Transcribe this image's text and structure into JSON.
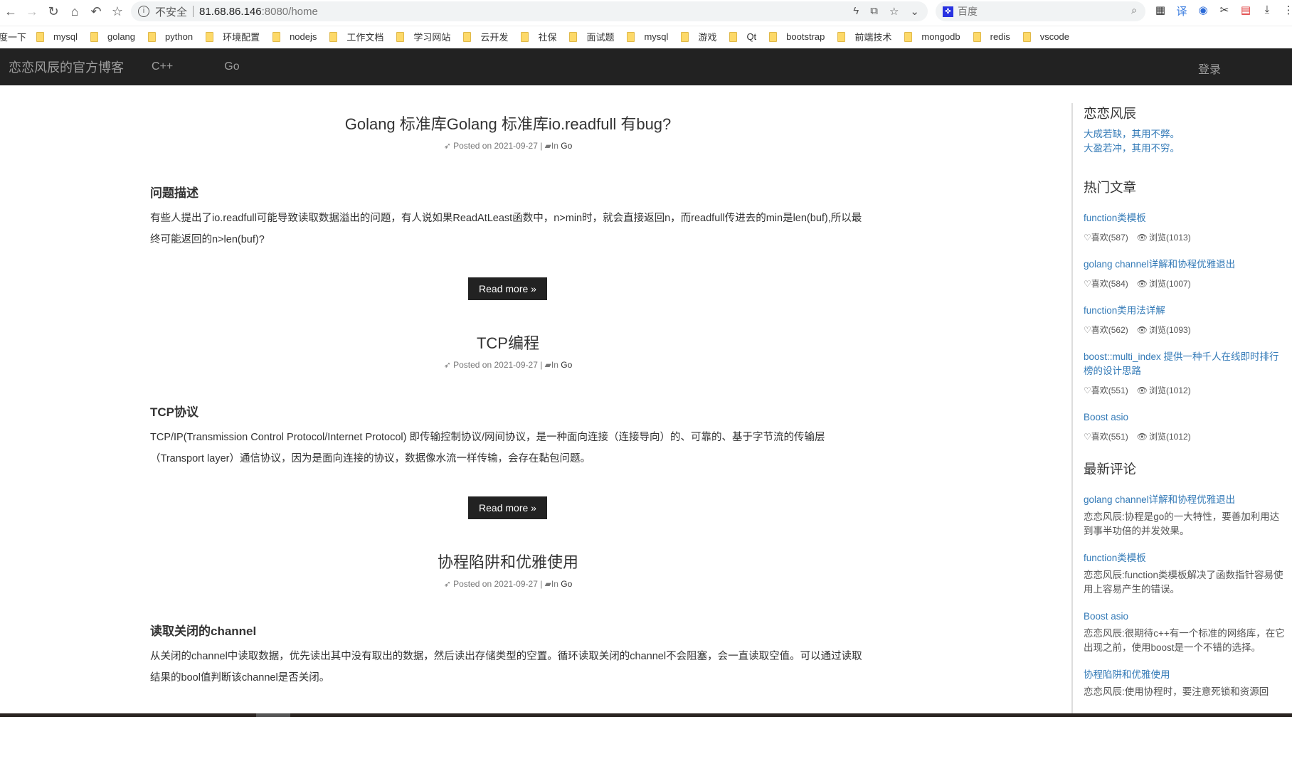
{
  "browser": {
    "url_host": "81.68.86.146",
    "url_path": ":8080/home",
    "insecure_label": "不安全",
    "search_placeholder": "百度",
    "bookmarks": [
      "mysql",
      "golang",
      "python",
      "环境配置",
      "nodejs",
      "工作文档",
      "学习网站",
      "云开发",
      "社保",
      "面试题",
      "mysql",
      "游戏",
      "Qt",
      "bootstrap",
      "前端技术",
      "mongodb",
      "redis",
      "vscode"
    ],
    "bookmark_first_partial": "度一下"
  },
  "navbar": {
    "brand": "恋恋风辰的官方博客",
    "links": [
      "C++",
      "Go"
    ],
    "login": "登录"
  },
  "posts": [
    {
      "title": "Golang 标准库Golang 标准库io.readfull 有bug?",
      "posted": "Posted on 2021-09-27 |",
      "category_prefix": "In",
      "category": "Go",
      "heading": "问题描述",
      "body": "有些人提出了io.readfull可能导致读取数据溢出的问题，有人说如果ReadAtLeast函数中，n>min时，就会直接返回n，而readfull传进去的min是len(buf),所以最终可能返回的n>len(buf)?",
      "read_more": "Read more »"
    },
    {
      "title": "TCP编程",
      "posted": "Posted on 2021-09-27 |",
      "category_prefix": "In",
      "category": "Go",
      "heading": "TCP协议",
      "body": "TCP/IP(Transmission Control Protocol/Internet Protocol) 即传输控制协议/网间协议，是一种面向连接（连接导向）的、可靠的、基于字节流的传输层（Transport layer）通信协议，因为是面向连接的协议，数据像水流一样传输，会存在黏包问题。",
      "read_more": "Read more »"
    },
    {
      "title": "协程陷阱和优雅使用",
      "posted": "Posted on 2021-09-27 |",
      "category_prefix": "In",
      "category": "Go",
      "heading": "读取关闭的channel",
      "body": "从关闭的channel中读取数据，优先读出其中没有取出的数据，然后读出存储类型的空置。循环读取关闭的channel不会阻塞，会一直读取空值。可以通过读取结果的bool值判断该channel是否关闭。"
    }
  ],
  "sidebar": {
    "author": "恋恋风辰",
    "quotes": [
      "大成若缺，其用不弊。",
      "大盈若冲，其用不穷。"
    ],
    "hot_title": "热门文章",
    "hot": [
      {
        "title": "function类模板",
        "likes": "♡喜欢(587)",
        "views": "浏览(1013)"
      },
      {
        "title": "golang channel详解和协程优雅退出",
        "likes": "♡喜欢(584)",
        "views": "浏览(1007)"
      },
      {
        "title": "function类用法详解",
        "likes": "♡喜欢(562)",
        "views": "浏览(1093)"
      },
      {
        "title": "boost::multi_index 提供一种千人在线即时排行榜的设计思路",
        "likes": "♡喜欢(551)",
        "views": "浏览(1012)"
      },
      {
        "title": "Boost asio",
        "likes": "♡喜欢(551)",
        "views": "浏览(1012)"
      }
    ],
    "comments_title": "最新评论",
    "comments": [
      {
        "title": "golang channel详解和协程优雅退出",
        "text": "恋恋风辰:协程是go的一大特性，要善加利用达到事半功倍的并发效果。"
      },
      {
        "title": "function类模板",
        "text": "恋恋风辰:function类模板解决了函数指针容易使用上容易产生的错误。"
      },
      {
        "title": "Boost asio",
        "text": "恋恋风辰:很期待c++有一个标准的网络库，在它出现之前，使用boost是一个不错的选择。"
      },
      {
        "title": "协程陷阱和优雅使用",
        "text": "恋恋风辰:使用协程时，要注意死锁和资源回"
      }
    ]
  }
}
